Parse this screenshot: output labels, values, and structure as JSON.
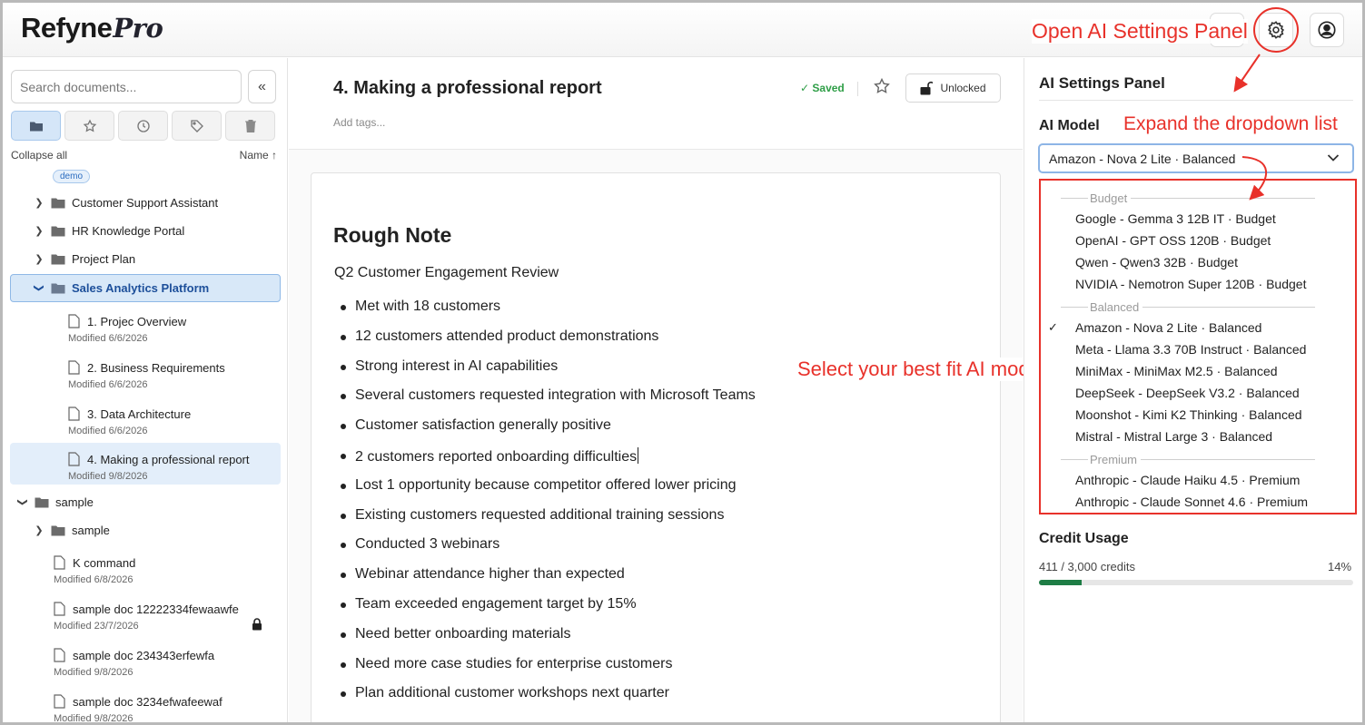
{
  "app": {
    "logo_main": "Refyne",
    "logo_pro": "Pro"
  },
  "annotations": {
    "open_settings": "Open AI Settings Panel",
    "expand_dropdown": "Expand the dropdown list",
    "select_model": "Select your best fit AI model"
  },
  "sidebar": {
    "search_placeholder": "Search documents...",
    "collapse_label": "«",
    "collapse_all": "Collapse all",
    "sort_label": "Name ↑",
    "tag": "demo",
    "folders": [
      {
        "label": "Customer Support Assistant"
      },
      {
        "label": "HR Knowledge Portal"
      },
      {
        "label": "Project Plan"
      },
      {
        "label": "Sales Analytics Platform"
      }
    ],
    "sales_docs": [
      {
        "title": "1. Projec Overview",
        "modified": "Modified 6/6/2026"
      },
      {
        "title": "2. Business Requirements",
        "modified": "Modified 6/6/2026"
      },
      {
        "title": "3. Data Architecture",
        "modified": "Modified 6/6/2026"
      },
      {
        "title": "4. Making a professional report",
        "modified": "Modified 9/8/2026"
      }
    ],
    "sample_folder": "sample",
    "sample_subfolder": "sample",
    "sample_docs": [
      {
        "title": "K command",
        "modified": "Modified 6/8/2026"
      },
      {
        "title": "sample doc 12222334fewaawfe",
        "modified": "Modified 23/7/2026"
      },
      {
        "title": "sample doc 234343erfewfa",
        "modified": "Modified 9/8/2026"
      },
      {
        "title": "sample doc 3234efwafeewaf",
        "modified": "Modified 9/8/2026"
      }
    ]
  },
  "document": {
    "title": "4. Making a professional report",
    "saved": "✓ Saved",
    "unlock_label": "Unlocked",
    "tags_placeholder": "Add tags...",
    "heading": "Rough Note",
    "subtitle": "Q2 Customer Engagement Review",
    "bullets": [
      "Met with 18 customers",
      "12 customers attended product demonstrations",
      "Strong interest in AI capabilities",
      "Several customers requested integration with Microsoft Teams",
      "Customer satisfaction generally positive",
      "2 customers reported onboarding difficulties",
      "Lost 1 opportunity because competitor offered lower pricing",
      "Existing customers requested additional training sessions",
      "Conducted 3 webinars",
      "Webinar attendance higher than expected",
      "Team exceeded engagement target by 15%",
      "Need better onboarding materials",
      "Need more case studies for enterprise customers",
      "Plan additional customer workshops next quarter"
    ]
  },
  "ai_panel": {
    "title": "AI Settings Panel",
    "model_label": "AI Model",
    "selected_model": "Amazon - Nova 2 Lite · Balanced",
    "groups": [
      {
        "name": "Budget",
        "options": [
          "Google - Gemma 3 12B IT · Budget",
          "OpenAI - GPT OSS 120B · Budget",
          "Qwen - Qwen3 32B · Budget",
          "NVIDIA - Nemotron Super 120B · Budget"
        ]
      },
      {
        "name": "Balanced",
        "options": [
          "Amazon - Nova 2 Lite · Balanced",
          "Meta - Llama 3.3 70B Instruct · Balanced",
          "MiniMax - MiniMax M2.5 · Balanced",
          "DeepSeek - DeepSeek V3.2 · Balanced",
          "Moonshot - Kimi K2 Thinking · Balanced",
          "Mistral - Mistral Large 3 · Balanced"
        ]
      },
      {
        "name": "Premium",
        "options": [
          "Anthropic - Claude Haiku 4.5 · Premium",
          "Anthropic - Claude Sonnet 4.6 · Premium"
        ]
      }
    ],
    "check_mark": "✓",
    "credit_label": "Credit Usage",
    "credit_value": "411 / 3,000 credits",
    "credit_percent": "14%",
    "credit_fraction": 0.137
  },
  "colors": {
    "accent": "#e8312a",
    "selected_bg": "#d8e8f8",
    "progress": "#1e7d45"
  }
}
